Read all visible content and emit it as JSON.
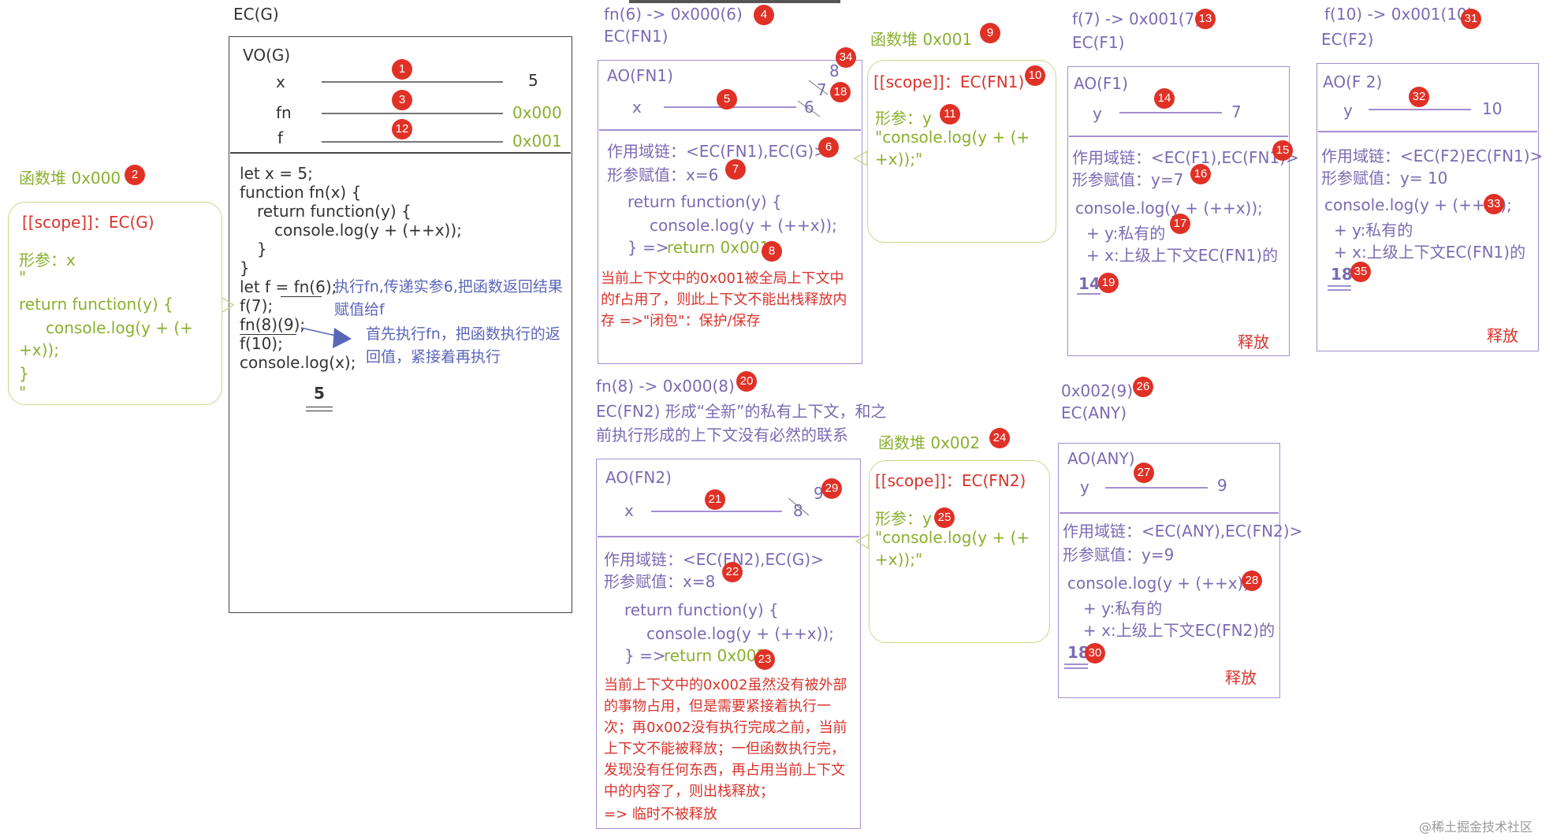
{
  "global": {
    "ec_label": "EC(G)",
    "vo_label": "VO(G)",
    "vars": [
      {
        "name": "x",
        "value": "5",
        "badge": "1"
      },
      {
        "name": "fn",
        "value": "0x000",
        "badge": "3"
      },
      {
        "name": "f",
        "value": "0x001",
        "badge": "12"
      }
    ],
    "code": [
      "let x = 5;",
      "function fn(x) {",
      "return function(y) {",
      "console.log(y + (++x));",
      "}",
      "}",
      "let f = fn(6);",
      "f(7);",
      "fn(8)(9);",
      "f(10);",
      "console.log(x);"
    ],
    "note1": "执行fn,传递实参6,把函数返回结果赋值给f",
    "note2": "首先执行fn，把函数执行的返回值，紧接着再执行",
    "output": "5"
  },
  "heap0": {
    "title": "函数堆 0x000",
    "badge": "2",
    "scope": "[[scope]]：EC(G)",
    "param": "形参：x",
    "q1": "\"",
    "code1": "return function(y) {",
    "code2": "console.log(y + (+",
    "code3": "+x));",
    "code4": "}",
    "q2": "\""
  },
  "fn1": {
    "call": "fn(6)  -> 0x000(6)",
    "call_badge": "4",
    "ec": "EC(FN1)",
    "ao": "AO(FN1)",
    "var": "x",
    "var_badge": "5",
    "vals": [
      "6",
      "7",
      "8"
    ],
    "badge_7": "18",
    "badge_8": "34",
    "scope": "作用域链：<EC(FN1),EC(G)>",
    "scope_badge": "6",
    "assign": "形参赋值：x=6",
    "assign_badge": "7",
    "c1": "return function(y) {",
    "c2": "console.log(y + (++x));",
    "c3": "} => ",
    "c3_return": "return 0x001",
    "c3_badge": "8",
    "note": "当前上下文中的0x001被全局上下文中的f占用了，则此上下文不能出栈释放内存 =>\"闭包\"：保护/保存"
  },
  "heap1": {
    "title": "函数堆 0x001",
    "badge": "9",
    "scope": "[[scope]]：EC(FN1)",
    "scope_badge": "10",
    "param": "形参：y",
    "param_badge": "11",
    "code1": "\"console.log(y + (+",
    "code2": "+x));\""
  },
  "f1": {
    "call": "f(7) -> 0x001(7)",
    "call_badge": "13",
    "ec": "EC(F1)",
    "ao": "AO(F1)",
    "var": "y",
    "var_badge": "14",
    "val": "7",
    "scope": "作用域链：<EC(F1),EC(FN1)>",
    "scope_badge": "15",
    "assign": "形参赋值：y=7",
    "assign_badge": "16",
    "c1": "console.log(y + (++x));",
    "c1_badge": "17",
    "c2": "+ y:私有的",
    "c3": "+ x:上级上下文EC(FN1)的",
    "result": "14",
    "result_badge": "19",
    "release": "释放"
  },
  "f2": {
    "call": "f(10) -> 0x001(10)",
    "call_badge": "31",
    "ec": "EC(F2)",
    "ao": "AO(F 2)",
    "var": "y",
    "var_badge": "32",
    "val": "10",
    "scope": "作用域链：<EC(F2)EC(FN1)>",
    "assign": "形参赋值：y= 10",
    "c1": "console.log(y + (++x));",
    "c1_badge": "33",
    "c2": "+ y:私有的",
    "c3": "+ x:上级上下文EC(FN1)的",
    "result": "18",
    "result_badge": "35",
    "release": "释放"
  },
  "fn2": {
    "call": "fn(8) -> 0x000(8)",
    "call_badge": "20",
    "ec_desc_1": "EC(FN2) 形成“全新”的私有上下文，和之",
    "ec_desc_2": "前执行形成的上下文没有必然的联系",
    "ao": "AO(FN2)",
    "var": "x",
    "var_badge": "21",
    "vals": [
      "8",
      "9"
    ],
    "badge_9": "29",
    "scope": "作用域链：<EC(FN2),EC(G)>",
    "assign": "形参赋值：x=8",
    "assign_badge": "22",
    "c1": "return function(y) {",
    "c2": "console.log(y + (++x));",
    "c3": "} => ",
    "c3_return": "return 0x002",
    "c3_badge": "23",
    "note": "当前上下文中的0x002虽然没有被外部的事物占用，但是需要紧接着执行一次；再0x002没有执行完成之前，当前上下文不能被释放；一但函数执行完，发现没有任何东西，再占用当前上下文中的内容了，则出栈释放；",
    "note2": "=> 临时不被释放"
  },
  "heap2": {
    "title": "函数堆 0x002",
    "badge": "24",
    "scope": "[[scope]]：EC(FN2)",
    "param": "形参：y",
    "param_badge": "25",
    "code1": "\"console.log(y + (+",
    "code2": "+x));\""
  },
  "any": {
    "call": "0x002(9)",
    "call_badge": "26",
    "ec": "EC(ANY)",
    "ao": "AO(ANY)",
    "var": "y",
    "var_badge": "27",
    "val": "9",
    "scope": "作用域链：<EC(ANY),EC(FN2)>",
    "assign": "形参赋值：y=9",
    "c1": "console.log(y + (++x));",
    "c1_badge": "28",
    "c2": "+ y:私有的",
    "c3": "+ x:上级上下文EC(FN2)的",
    "result": "18",
    "result_badge": "30",
    "release": "释放"
  },
  "watermark": "@稀土掘金技术社区"
}
